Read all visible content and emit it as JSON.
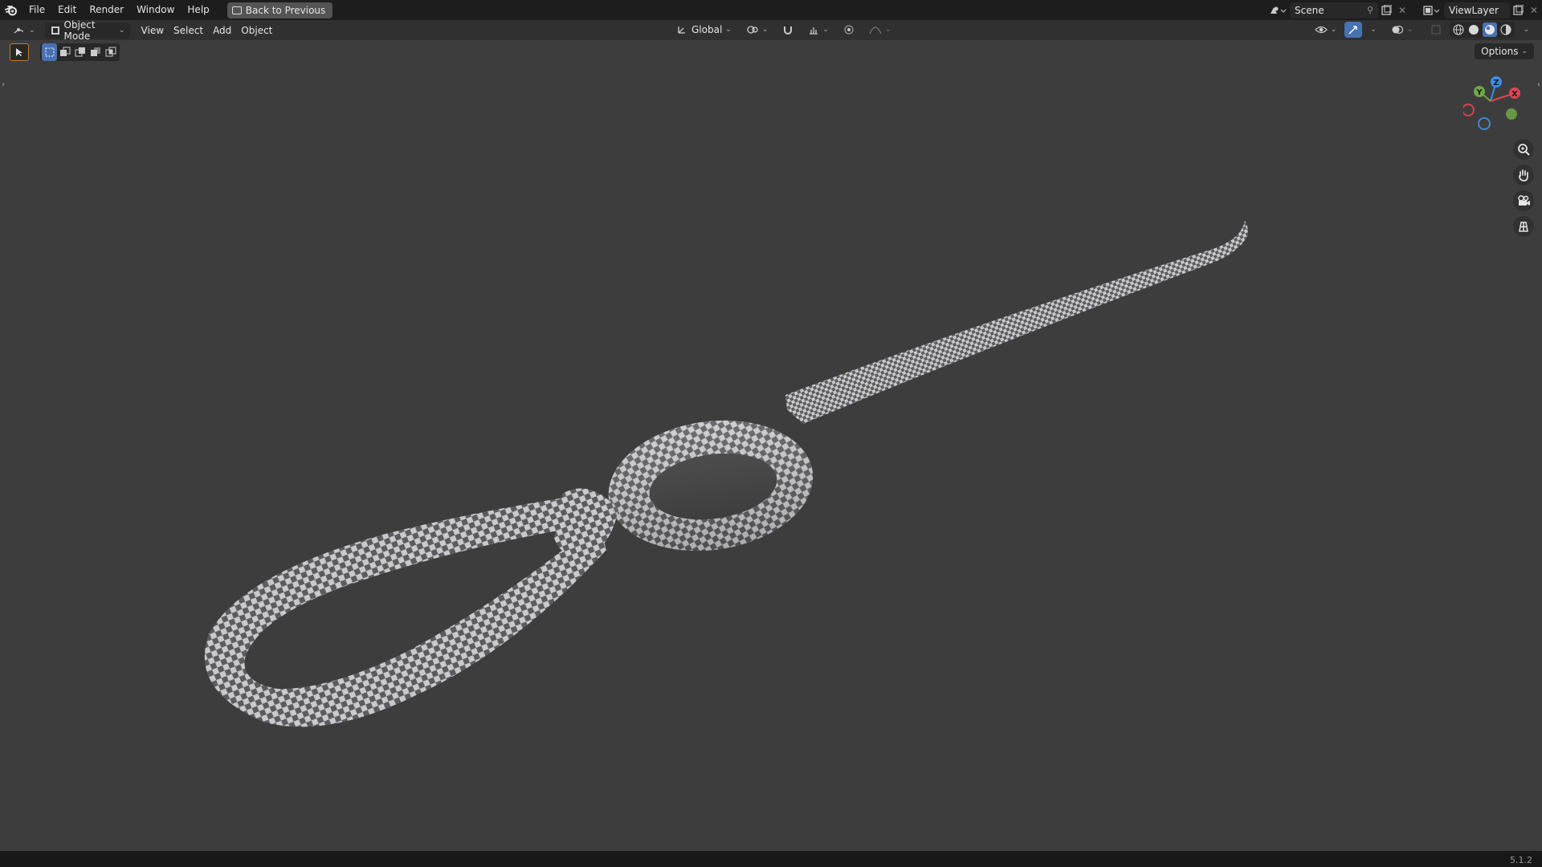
{
  "topbar": {
    "menus": [
      "File",
      "Edit",
      "Render",
      "Window",
      "Help"
    ],
    "back_button": "Back to Previous",
    "scene_name": "Scene",
    "view_layer": "ViewLayer"
  },
  "viewport_header": {
    "mode": "Object Mode",
    "menus": [
      "View",
      "Select",
      "Add",
      "Object"
    ],
    "transform_orientation": "Global"
  },
  "viewport": {
    "options_label": "Options",
    "gizmo_axes": {
      "x": "X",
      "y": "Y",
      "z": "Z"
    },
    "axis_colors": {
      "x": "#e54356",
      "y": "#6ea844",
      "z": "#3e8ee6"
    },
    "nav_icons": [
      "zoom-icon",
      "pan-hand-icon",
      "camera-icon",
      "perspective-grid-icon"
    ]
  },
  "status_bar": {
    "version": "5.1.2"
  },
  "colors": {
    "accent": "#4772b3",
    "background": "#3d3d3d",
    "topbar": "#1d1d1d"
  }
}
